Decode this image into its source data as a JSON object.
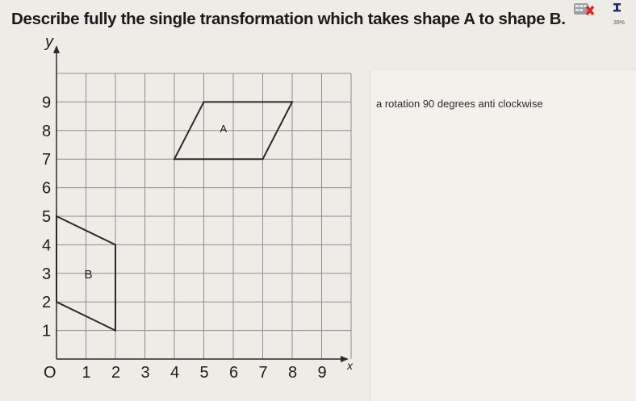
{
  "question": {
    "prefix": "Describe fully the ",
    "emphasis": "single",
    "suffix": " transformation which takes shape A to shape B."
  },
  "axes": {
    "y_label": "y",
    "x_label": "x",
    "origin_label": "O",
    "x_ticks": [
      "1",
      "2",
      "3",
      "4",
      "5",
      "6",
      "7",
      "8",
      "9"
    ],
    "y_ticks": [
      "1",
      "2",
      "3",
      "4",
      "5",
      "6",
      "7",
      "8",
      "9"
    ]
  },
  "shapes": {
    "A": {
      "label": "A",
      "vertices": [
        [
          4,
          7
        ],
        [
          5,
          9
        ],
        [
          8,
          9
        ],
        [
          7,
          7
        ]
      ]
    },
    "B": {
      "label": "B",
      "vertices": [
        [
          0,
          5
        ],
        [
          2,
          4
        ],
        [
          2,
          1
        ],
        [
          0,
          2
        ]
      ]
    }
  },
  "answer": {
    "text": "a rotation 90 degrees anti clockwise"
  },
  "status": {
    "counter": "39%",
    "icons": [
      "calculator-icon",
      "cross-icon",
      "person-icon"
    ],
    "cross_color": "#d62828",
    "person_color": "#1f2d6b"
  }
}
